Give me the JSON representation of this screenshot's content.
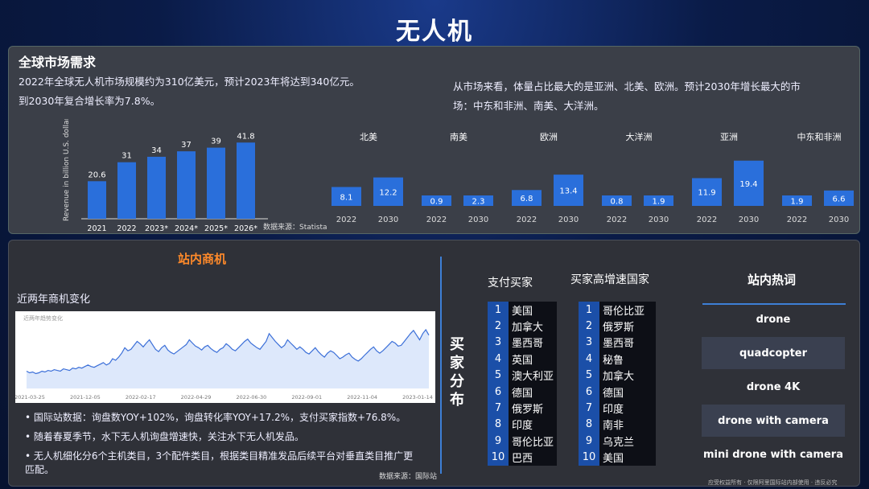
{
  "title": "无人机",
  "top": {
    "section_title": "全球市场需求",
    "desc_left_1": "2022年全球无人机市场规模约为310亿美元，预计2023年将达到340亿元。",
    "desc_left_2": "到2030年复合增长率为7.8%。",
    "desc_right_1": "从市场来看，体量占比最大的是亚洲、北美、欧洲。预计2030年增长最大的市",
    "desc_right_2": "场：中东和非洲、南美、大洋洲。",
    "source": "数据来源：Statista"
  },
  "chart_data": [
    {
      "type": "bar",
      "ylabel": "Revenue in billion U.S. dollars",
      "categories": [
        "2021",
        "2022",
        "2023*",
        "2024*",
        "2025*",
        "2026*"
      ],
      "values": [
        20.6,
        31,
        34,
        37,
        39,
        41.8
      ],
      "color": "#2a6fdb"
    },
    {
      "type": "bar",
      "groups": [
        {
          "region": "北美",
          "values": [
            8.1,
            12.2
          ]
        },
        {
          "region": "南美",
          "values": [
            0.9,
            2.3
          ]
        },
        {
          "region": "欧洲",
          "values": [
            6.8,
            13.4
          ]
        },
        {
          "region": "大洋洲",
          "values": [
            0.8,
            1.9
          ]
        },
        {
          "region": "亚洲",
          "values": [
            11.9,
            19.4
          ]
        },
        {
          "region": "中东和非洲",
          "values": [
            1.9,
            6.6
          ]
        }
      ],
      "years": [
        "2022",
        "2030"
      ],
      "color": "#2a6fdb"
    },
    {
      "type": "line",
      "title": "近两年商机变化",
      "inner_title": "近两年趋势变化",
      "x_ticks": [
        "2021-03-25",
        "2021-12-05",
        "2022-02-17",
        "2022-04-29",
        "2022-06-30",
        "2022-09-01",
        "2022-11-04",
        "2023-01-14"
      ],
      "note": "trend series shape approximated",
      "values": [
        22,
        20,
        21,
        19,
        20,
        22,
        21,
        23,
        22,
        24,
        23,
        22,
        25,
        24,
        23,
        26,
        25,
        27,
        26,
        28,
        30,
        28,
        27,
        29,
        31,
        33,
        30,
        32,
        38,
        36,
        40,
        45,
        52,
        48,
        50,
        55,
        60,
        57,
        53,
        58,
        62,
        56,
        50,
        47,
        52,
        55,
        49,
        46,
        44,
        47,
        50,
        53,
        56,
        62,
        58,
        54,
        52,
        49,
        53,
        55,
        51,
        48,
        46,
        50,
        52,
        57,
        54,
        50,
        48,
        52,
        56,
        60,
        63,
        58,
        55,
        52,
        50,
        55,
        60,
        70,
        65,
        60,
        56,
        52,
        55,
        62,
        58,
        54,
        50,
        53,
        50,
        46,
        44,
        48,
        52,
        47,
        43,
        40,
        45,
        48,
        46,
        42,
        38,
        40,
        43,
        45,
        40,
        37,
        35,
        38,
        42,
        46,
        50,
        53,
        48,
        45,
        48,
        52,
        56,
        60,
        58,
        54,
        55,
        60,
        65,
        70,
        74,
        68,
        62,
        70,
        75,
        68
      ]
    }
  ],
  "bottom": {
    "section_title": "站内商机",
    "chart_title": "近两年商机变化",
    "bullets": [
      "国际站数据：询盘数YOY+102%，询盘转化率YOY+17.2%，支付买家指数+76.8%。",
      "随着春夏季节，水下无人机询盘增速快，关注水下无人机发品。",
      "无人机细化分6个主机类目，3个配件类目，根据类目精准发品后续平台对垂直类目推广更匹配。"
    ],
    "source": "数据来源：国际站",
    "buyer_label": "买家分布",
    "pay_title": "支付买家",
    "pay_list": [
      "美国",
      "加拿大",
      "墨西哥",
      "英国",
      "澳大利亚",
      "德国",
      "俄罗斯",
      "印度",
      "哥伦比亚",
      "巴西"
    ],
    "growth_title": "买家高增速国家",
    "growth_list": [
      "哥伦比亚",
      "俄罗斯",
      "墨西哥",
      "秘鲁",
      "加拿大",
      "德国",
      "印度",
      "南非",
      "乌克兰",
      "美国"
    ],
    "hot_title": "站内热词",
    "hot_words": [
      "drone",
      "quadcopter",
      "drone 4K",
      "drone with camera",
      "mini drone with camera"
    ],
    "footer": "应受权益所有 · 仅限阿里国际站内部使用 · 违反必究"
  }
}
